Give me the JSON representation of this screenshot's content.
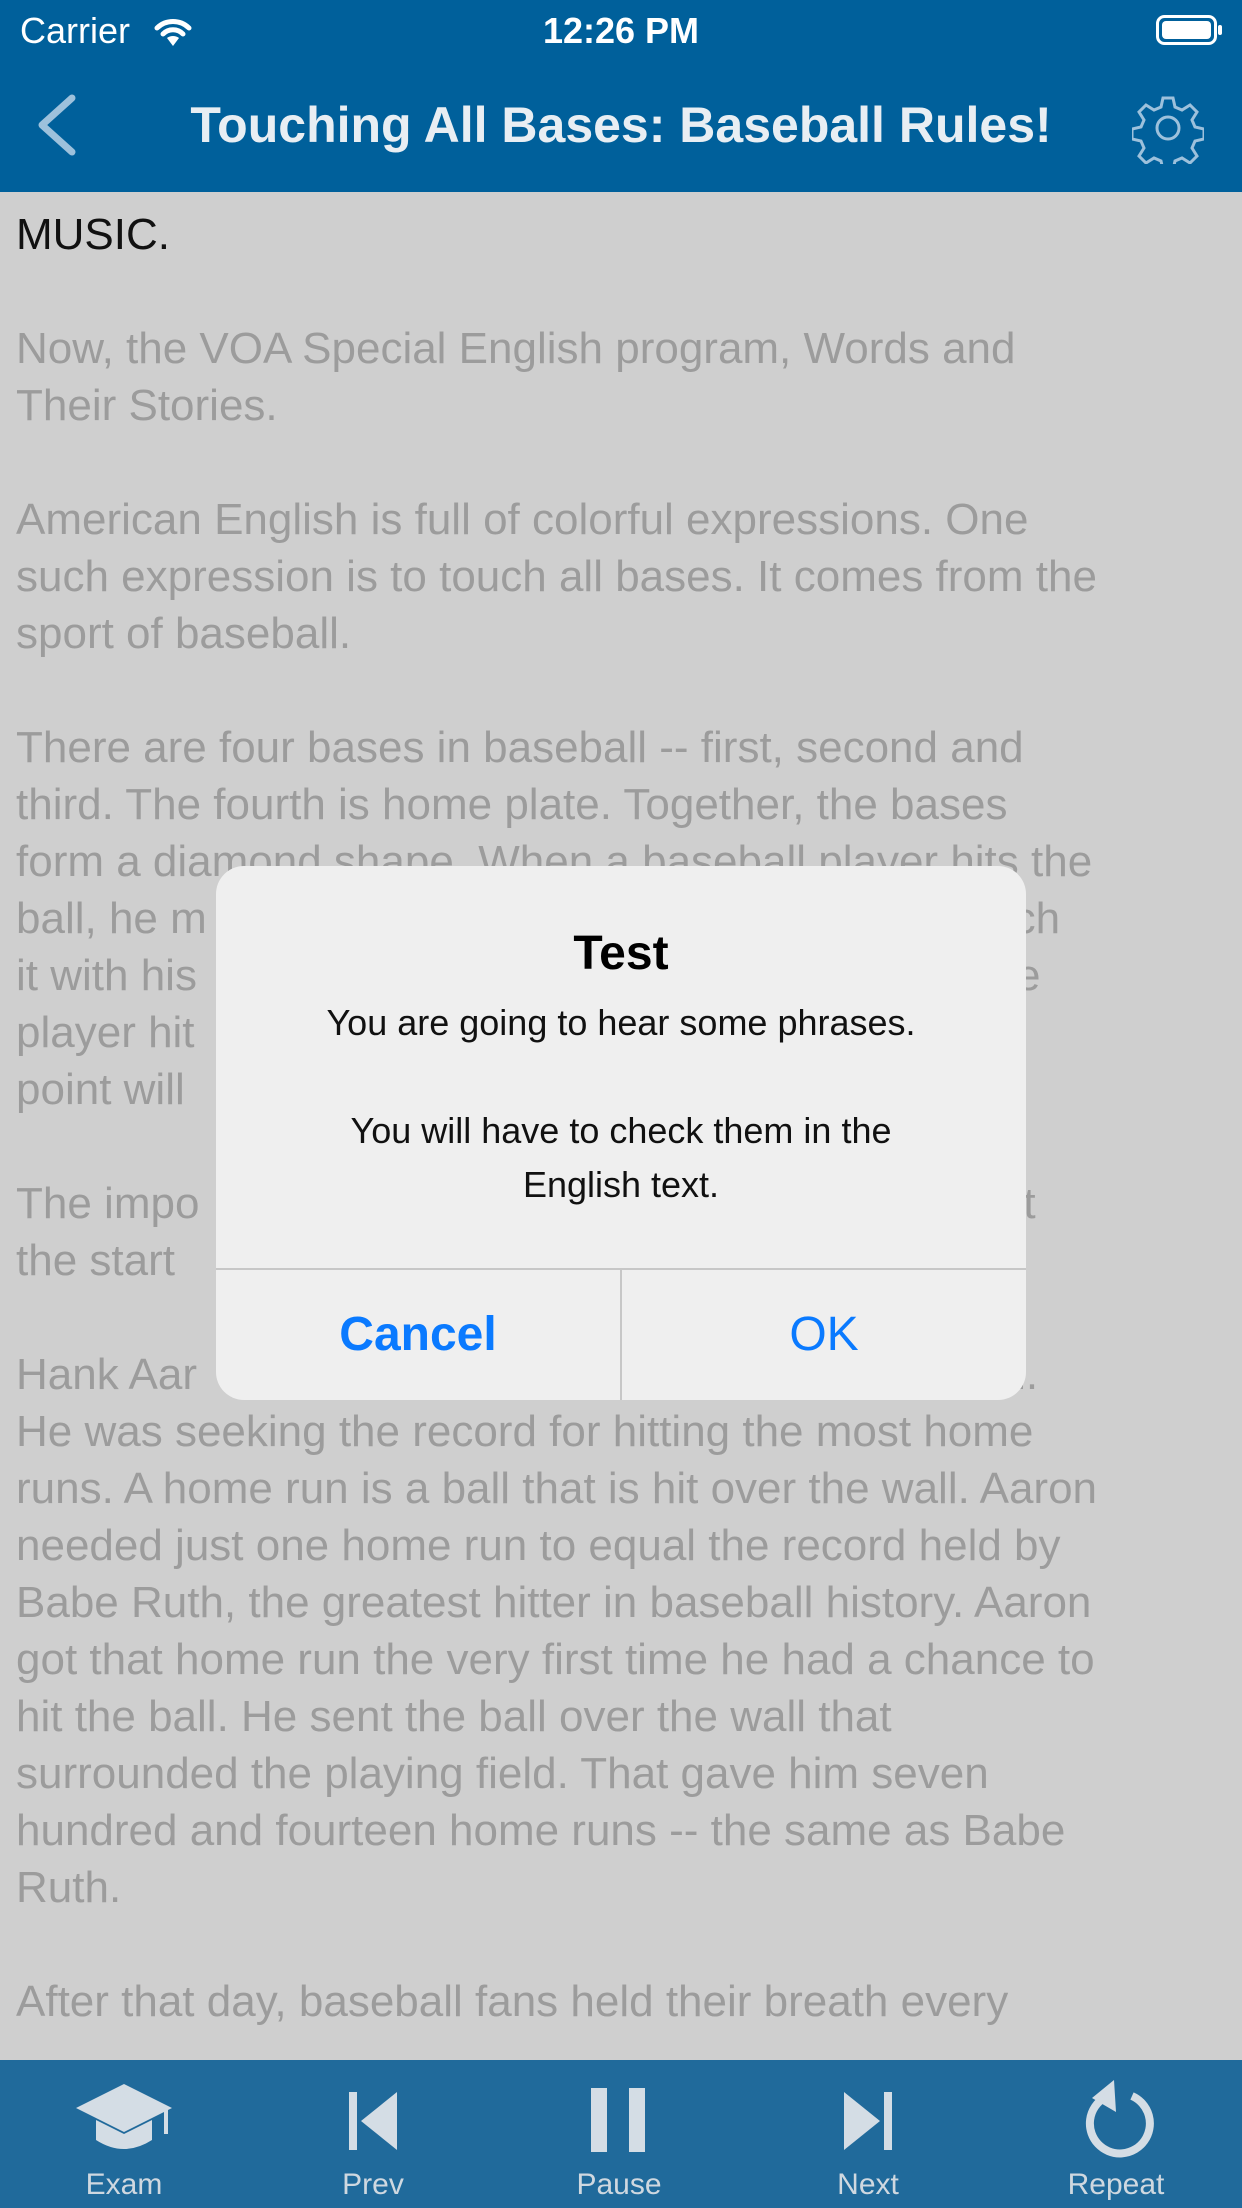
{
  "status": {
    "carrier": "Carrier",
    "time": "12:26 PM"
  },
  "nav": {
    "title": "Touching All Bases: Baseball Rules!"
  },
  "content": {
    "paragraphs": [
      "MUSIC.",
      "Now, the VOA Special English program, Words and Their Stories.",
      "American English is full of colorful expressions. One such expression is to touch all bases. It comes from the sport of baseball.",
      "There are four bases in baseball -- first, second and third. The fourth is home plate. Together, the bases form a diamond shape. When a baseball player hits the ball, he m... d touch it with his ... nt. If the player hit ... ses, the point will ...",
      "The impo ... shown at the start ... season.",
      "Hank Aar ... es team. He was seeking the record for hitting the most home runs. A home run is a ball that is hit over the wall. Aaron needed just one home run to equal the record held by Babe Ruth, the greatest hitter in baseball history. Aaron got that home run the very first time he had a chance to hit the ball. He sent the ball over the wall that surrounded the playing field. That gave him seven hundred and fourteen home runs -- the same as Babe Ruth.",
      "After that day, baseball fans held their breath every"
    ],
    "lines": [
      "MUSIC.",
      "",
      "Now, the VOA Special English program, Words and",
      "Their Stories.",
      "",
      "American English is full of colorful expressions. One",
      "such expression is to touch all bases. It comes from the",
      "sport of baseball.",
      "",
      "There are four bases in baseball -- first, second and",
      "third. The fourth is home plate. Together, the bases",
      "form a diamond shape. When a baseball player hits the",
      "ball, he m                                                          d touch",
      "it with his                                                        nt. If the",
      "player hit                                                       ses, the",
      "point will",
      "",
      "The impo                                                      shown at",
      "the start                                                       season.",
      "",
      "Hank Aar                                                       es team.",
      "He was seeking the record for hitting the most home",
      "runs. A home run is a ball that is hit over the wall. Aaron",
      "needed just one home run to equal the record held by",
      "Babe Ruth, the greatest hitter in baseball history. Aaron",
      "got that home run the very first time he had a chance to",
      "hit the ball. He sent the ball over the wall that",
      "surrounded the playing field. That gave him seven",
      "hundred and fourteen home runs -- the same as Babe",
      "Ruth.",
      "",
      "After that day, baseball fans held their breath every"
    ]
  },
  "alert": {
    "title": "Test",
    "message_line1": "You are going to hear some phrases.",
    "message_line2": "You will have to check them in the",
    "message_line3": "English text.",
    "cancel": "Cancel",
    "ok": "OK"
  },
  "toolbar": {
    "exam": "Exam",
    "prev": "Prev",
    "pause": "Pause",
    "next": "Next",
    "repeat": "Repeat"
  },
  "colors": {
    "nav_bg": "#00609b",
    "toolbar_bg": "#206a9b",
    "alert_button": "#0a7aff"
  }
}
